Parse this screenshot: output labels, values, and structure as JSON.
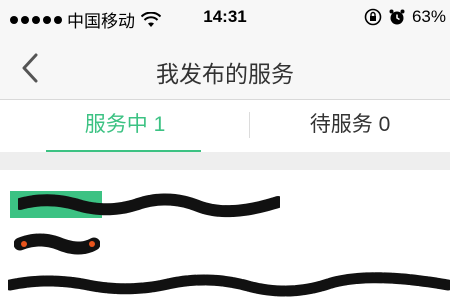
{
  "status_bar": {
    "carrier": "中国移动",
    "time": "14:31",
    "battery": "63%",
    "icons": [
      "signal-icon",
      "wifi-icon",
      "orientation-lock-icon",
      "alarm-icon"
    ]
  },
  "nav": {
    "title": "我发布的服务",
    "back_icon": "chevron-left-icon"
  },
  "tabs": [
    {
      "label": "服务中 1",
      "active": true
    },
    {
      "label": "待服务 0",
      "active": false
    }
  ],
  "colors": {
    "accent": "#3cc283",
    "nav_bg": "#f7f7f7",
    "gap_bg": "#eeeeee",
    "price_accent": "#e8541c"
  }
}
